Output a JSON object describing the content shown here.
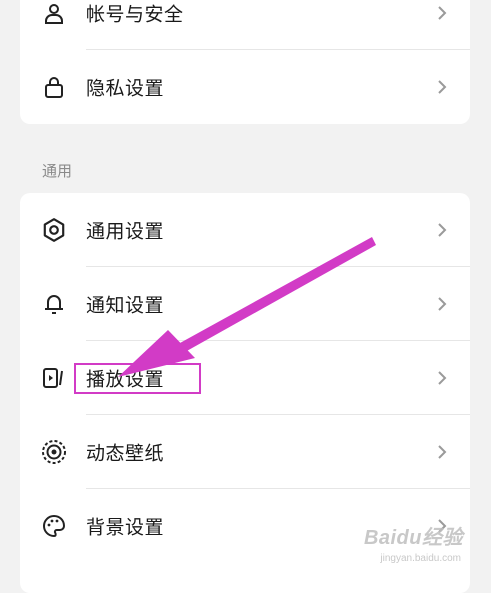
{
  "account_group": {
    "items": [
      {
        "label": "帐号与安全",
        "icon": "person-icon"
      },
      {
        "label": "隐私设置",
        "icon": "lock-icon"
      }
    ]
  },
  "general_group": {
    "title": "通用",
    "items": [
      {
        "label": "通用设置",
        "icon": "gear-icon"
      },
      {
        "label": "通知设置",
        "icon": "bell-icon"
      },
      {
        "label": "播放设置",
        "icon": "play-screen-icon"
      },
      {
        "label": "动态壁纸",
        "icon": "live-wallpaper-icon"
      },
      {
        "label": "背景设置",
        "icon": "palette-icon"
      }
    ]
  },
  "annotation": {
    "highlight_color": "#d23bc6"
  },
  "watermark": {
    "text": "Baidu经验",
    "sub": "jingyan.baidu.com"
  }
}
